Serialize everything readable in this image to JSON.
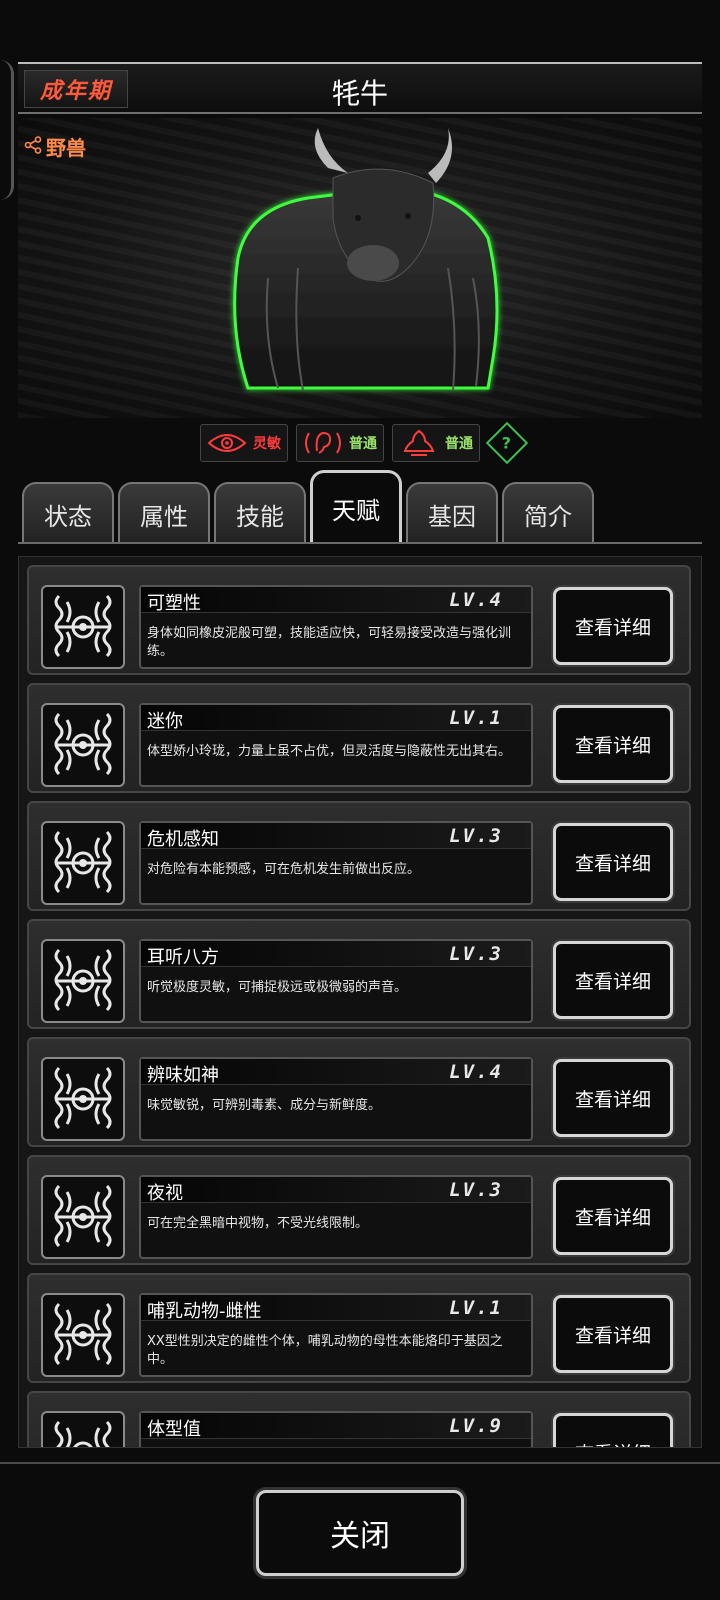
{
  "header": {
    "stage": "成年期",
    "name": "牦牛"
  },
  "portrait": {
    "type_tag": "野兽",
    "glow_color": "#3cff3c"
  },
  "senses": [
    {
      "icon": "eye-icon",
      "label": "灵敏",
      "color": "#ff3b3b"
    },
    {
      "icon": "ear-icon",
      "label": "普通",
      "color": "#9be36a"
    },
    {
      "icon": "nose-icon",
      "label": "普通",
      "color": "#9be36a"
    }
  ],
  "tabs": [
    "状态",
    "属性",
    "技能",
    "天赋",
    "基因",
    "简介"
  ],
  "active_tab": "天赋",
  "talents": [
    {
      "name": "可塑性",
      "level": "LV.4",
      "desc": "身体如同橡皮泥般可塑，技能适应快，可轻易接受改造与强化训练。",
      "button": "查看详细"
    },
    {
      "name": "迷你",
      "level": "LV.1",
      "desc": "体型娇小玲珑，力量上虽不占优，但灵活度与隐蔽性无出其右。",
      "button": "查看详细"
    },
    {
      "name": "危机感知",
      "level": "LV.3",
      "desc": "对危险有本能预感，可在危机发生前做出反应。",
      "button": "查看详细"
    },
    {
      "name": "耳听八方",
      "level": "LV.3",
      "desc": "听觉极度灵敏，可捕捉极远或极微弱的声音。",
      "button": "查看详细"
    },
    {
      "name": "辨味如神",
      "level": "LV.4",
      "desc": "味觉敏锐，可辨别毒素、成分与新鲜度。",
      "button": "查看详细"
    },
    {
      "name": "夜视",
      "level": "LV.3",
      "desc": "可在完全黑暗中视物，不受光线限制。",
      "button": "查看详细"
    },
    {
      "name": "哺乳动物-雌性",
      "level": "LV.1",
      "desc": "XX型性别决定的雌性个体，哺乳动物的母性本能烙印于基因之中。",
      "button": "查看详细"
    },
    {
      "name": "体型值",
      "level": "LV.9",
      "desc": "",
      "button": "查看详细"
    }
  ],
  "footer": {
    "close_label": "关闭"
  }
}
